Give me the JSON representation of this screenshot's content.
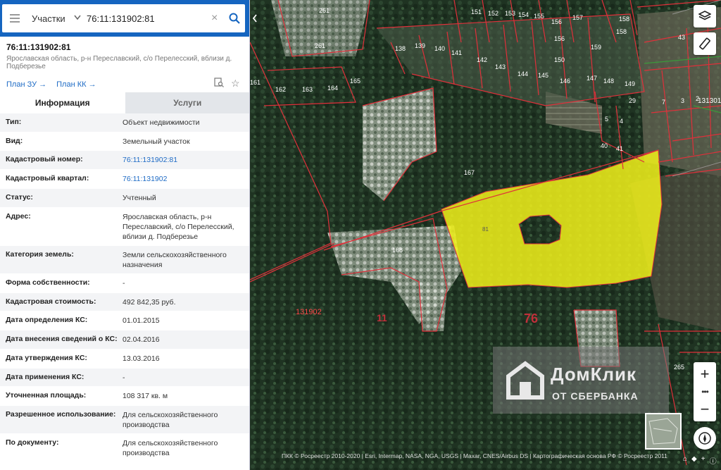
{
  "search": {
    "mode_label": "Участки",
    "query": "76:11:131902:81"
  },
  "parcel": {
    "title": "76:11:131902:81",
    "address_short": "Ярославская область, р-н Переславский, с/о Перелесский, вблизи д. Подберезье",
    "links": [
      "План ЗУ →",
      "План КК →"
    ]
  },
  "tabs": [
    "Информация",
    "Услуги"
  ],
  "info_rows": [
    {
      "key": "Тип:",
      "value": "Объект недвижимости",
      "link": false
    },
    {
      "key": "Вид:",
      "value": "Земельный участок",
      "link": false
    },
    {
      "key": "Кадастровый номер:",
      "value": "76:11:131902:81",
      "link": true
    },
    {
      "key": "Кадастровый квартал:",
      "value": "76:11:131902",
      "link": true
    },
    {
      "key": "Статус:",
      "value": "Учтенный",
      "link": false
    },
    {
      "key": "Адрес:",
      "value": "Ярославская область, р-н Переславский, с/о Перелесский, вблизи д. Подберезье",
      "link": false
    },
    {
      "key": "Категория земель:",
      "value": "Земли сельскохозяйственного назначения",
      "link": false
    },
    {
      "key": "Форма собственности:",
      "value": "-",
      "link": false
    },
    {
      "key": "Кадастровая стоимость:",
      "value": "492 842,35 руб.",
      "link": false
    },
    {
      "key": "Дата определения КС:",
      "value": "01.01.2015",
      "link": false
    },
    {
      "key": "Дата внесения сведений о КС:",
      "value": "02.04.2016",
      "link": false
    },
    {
      "key": "Дата утверждения КС:",
      "value": "13.03.2016",
      "link": false
    },
    {
      "key": "Дата применения КС:",
      "value": "-",
      "link": false
    },
    {
      "key": "Уточненная площадь:",
      "value": "108 317 кв. м",
      "link": false
    },
    {
      "key": "Разрешенное использование:",
      "value": "Для сельскохозяйственного производства",
      "link": false
    },
    {
      "key": "По документу:",
      "value": "Для сельскохозяйственного производства",
      "link": false
    }
  ],
  "map_labels": {
    "quarter": "131902",
    "region": "76",
    "district": "11",
    "selected": "81",
    "parcels": [
      "261",
      "261",
      "151",
      "152",
      "153",
      "154",
      "155",
      "156",
      "157",
      "158",
      "158",
      "156",
      "159",
      "150",
      "140",
      "141",
      "142",
      "143",
      "144",
      "145",
      "146",
      "147",
      "148",
      "149",
      "139",
      "138",
      "162",
      "163",
      "164",
      "165",
      "161",
      "167",
      "168",
      "29",
      "41",
      "40",
      "5",
      "4",
      "7",
      "3",
      "2",
      "131301",
      "265",
      "43"
    ]
  },
  "watermark": {
    "line1": "ДомКлик",
    "line2": "ОТ СБЕРБАНКА"
  },
  "attribution": "ПКК © Росреестр 2010-2020 | Esri, Intermap, NASA, NGA, USGS | Maxar, CNES/Airbus DS | Картографическая основа РФ © Росреестр 2011",
  "colors": {
    "accent": "#1565c0",
    "link": "#1e6bc5",
    "parcel_border": "#e0303a",
    "selected_fill": "#f2f21a"
  }
}
